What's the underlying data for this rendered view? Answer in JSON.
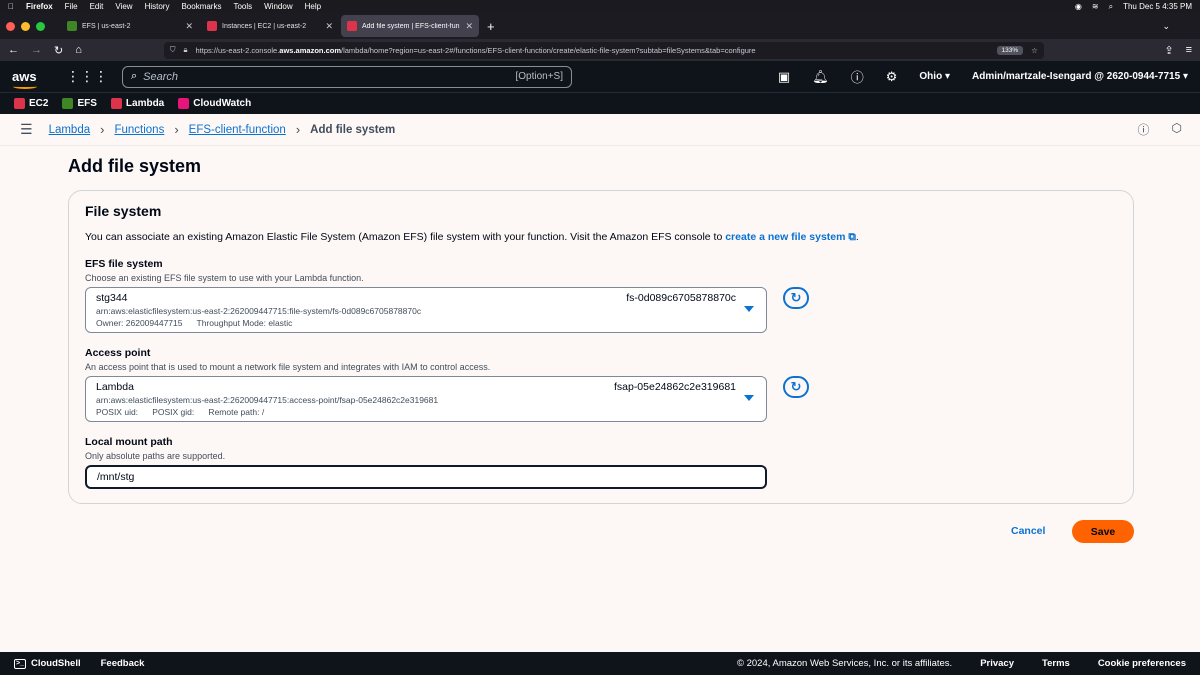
{
  "mac_menu": {
    "apple": "",
    "app": "Firefox",
    "items": [
      "File",
      "Edit",
      "View",
      "History",
      "Bookmarks",
      "Tools",
      "Window",
      "Help"
    ],
    "clock": "Thu Dec 5  4:35 PM"
  },
  "browser": {
    "tabs": [
      {
        "label": "EFS | us-east-2",
        "color": "#3f8624"
      },
      {
        "label": "Instances | EC2 | us-east-2",
        "color": "#dd344c"
      },
      {
        "label": "Add file system | EFS-client-fun",
        "color": "#dd344c"
      }
    ],
    "url_prefix": "https://us-east-2.console.",
    "url_domain": "aws.amazon.com",
    "url_suffix": "/lambda/home?region=us-east-2#/functions/EFS-client-function/create/elastic-file-system?subtab=fileSystems&tab=configure",
    "zoom": "133%"
  },
  "aws_nav": {
    "logo": "aws",
    "search_placeholder": "Search",
    "search_shortcut": "[Option+S]",
    "region": "Ohio",
    "account": "Admin/martzale-Isengard @ 2620-0944-7715"
  },
  "services": [
    {
      "label": "EC2",
      "color": "#dd344c"
    },
    {
      "label": "EFS",
      "color": "#3f8624"
    },
    {
      "label": "Lambda",
      "color": "#dd344c"
    },
    {
      "label": "CloudWatch",
      "color": "#e7157b"
    }
  ],
  "breadcrumb": {
    "items": [
      "Lambda",
      "Functions",
      "EFS-client-function"
    ],
    "current": "Add file system"
  },
  "page": {
    "title": "Add file system",
    "panel_title": "File system",
    "panel_desc": "You can associate an existing Amazon Elastic File System (Amazon EFS) file system with your function. Visit the Amazon EFS console to ",
    "panel_link": "create a new file system",
    "panel_end": "."
  },
  "efs": {
    "label": "EFS file system",
    "desc": "Choose an existing EFS file system to use with your Lambda function.",
    "name": "stg344",
    "id": "fs-0d089c6705878870c",
    "arn": "arn:aws:elasticfilesystem:us-east-2:262009447715:file-system/fs-0d089c6705878870c",
    "meta": "Owner: 262009447715      Throughput Mode: elastic"
  },
  "access_point": {
    "label": "Access point",
    "desc": "An access point that is used to mount a network file system and integrates with IAM to control access.",
    "name": "Lambda",
    "id": "fsap-05e24862c2e319681",
    "arn": "arn:aws:elasticfilesystem:us-east-2:262009447715:access-point/fsap-05e24862c2e319681",
    "meta": "POSIX uid:      POSIX gid:      Remote path: /"
  },
  "mount": {
    "label": "Local mount path",
    "desc": "Only absolute paths are supported.",
    "value": "/mnt/stg"
  },
  "actions": {
    "cancel": "Cancel",
    "save": "Save"
  },
  "footer": {
    "cloudshell": "CloudShell",
    "feedback": "Feedback",
    "copyright": "© 2024, Amazon Web Services, Inc. or its affiliates.",
    "links": [
      "Privacy",
      "Terms",
      "Cookie preferences"
    ]
  },
  "colors": {
    "link": "#0972d3",
    "primary_button": "#ff6200",
    "nav_bg": "#0f141a"
  }
}
